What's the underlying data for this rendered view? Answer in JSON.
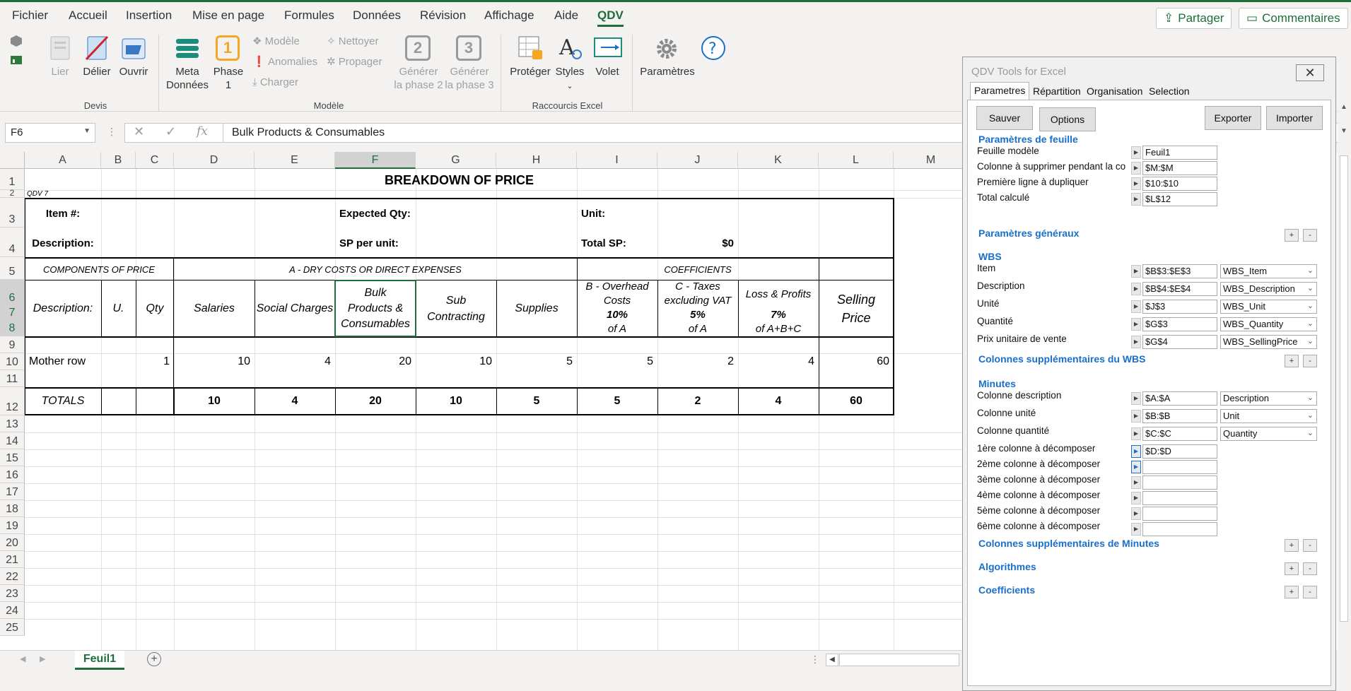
{
  "menu": {
    "items": [
      "Fichier",
      "Accueil",
      "Insertion",
      "Mise en page",
      "Formules",
      "Données",
      "Révision",
      "Affichage",
      "Aide",
      "QDV"
    ],
    "share": "Partager",
    "comments": "Commentaires"
  },
  "ribbon": {
    "lier": "Lier",
    "delier": "Délier",
    "ouvrir": "Ouvrir",
    "devis_group": "Devis",
    "meta": "Meta",
    "donnees": "Données",
    "phase": "Phase",
    "phase_num": "1",
    "modele_item": "Modèle",
    "anomalies": "Anomalies",
    "charger": "Charger",
    "nettoyer": "Nettoyer",
    "propager": "Propager",
    "generer": "Générer",
    "phase2": "la phase 2",
    "phase3": "la phase 3",
    "num2": "2",
    "num3": "3",
    "modele_group": "Modèle",
    "proteger": "Protéger",
    "styles": "Styles",
    "volet": "Volet",
    "raccourcis_group": "Raccourcis Excel",
    "parametres": "Paramètres"
  },
  "formula": {
    "namebox": "F6",
    "content": "Bulk Products & Consumables"
  },
  "grid": {
    "columns": [
      "A",
      "B",
      "C",
      "D",
      "E",
      "F",
      "G",
      "H",
      "I",
      "J",
      "K",
      "L",
      "M"
    ],
    "rows": [
      "1",
      "2",
      "3",
      "4",
      "5",
      "6",
      "7",
      "8",
      "9",
      "10",
      "11",
      "12",
      "13",
      "14",
      "15",
      "16",
      "17",
      "18",
      "19",
      "20",
      "21",
      "22",
      "23",
      "24",
      "25"
    ]
  },
  "sheet": {
    "title": "BREAKDOWN OF PRICE",
    "qdv": "QDV 7",
    "item": "Item #:",
    "description": "Description:",
    "expected_qty": "Expected Qty:",
    "sp_per_unit": "SP per unit:",
    "unit": "Unit:",
    "total_sp": "Total SP:",
    "total_sp_value": "$0",
    "components": "COMPONENTS OF PRICE",
    "dry_costs": "A - DRY COSTS OR DIRECT EXPENSES",
    "coefficients": "COEFFICIENTS",
    "h_description": "Description:",
    "h_unit": "U.",
    "h_qty": "Qty",
    "h_salaries": "Salaries",
    "h_social": "Social Charges",
    "h_bulk": "Bulk Products & Consumables",
    "h_sub": "Sub Contracting",
    "h_supplies": "Supplies",
    "h_overhead": "B - Overhead Costs",
    "h_taxes": "C - Taxes excluding VAT",
    "h_loss": "Loss & Profits",
    "h_selling": "Selling Price",
    "pct_b": "10%",
    "pct_c": "5%",
    "pct_k": "7%",
    "of_a": "of A",
    "of_a2": "of A",
    "of_abc": "of A+B+C",
    "mother_row": {
      "label": "Mother row",
      "qty": "1",
      "salaries": "10",
      "social": "4",
      "bulk": "20",
      "sub": "10",
      "supplies": "5",
      "overhead": "5",
      "taxes": "2",
      "loss": "4",
      "selling": "60"
    },
    "totals": {
      "label": "TOTALS",
      "salaries": "10",
      "social": "4",
      "bulk": "20",
      "sub": "10",
      "supplies": "5",
      "overhead": "5",
      "taxes": "2",
      "loss": "4",
      "selling": "60"
    }
  },
  "tabs": {
    "sheet1": "Feuil1"
  },
  "panel": {
    "title": "QDV Tools for Excel",
    "close": "✕",
    "tabs": [
      "Parametres",
      "Répartition",
      "Organisation",
      "Selection"
    ],
    "buttons": {
      "sauver": "Sauver",
      "options": "Options",
      "exporter": "Exporter",
      "importer": "Importer"
    },
    "sec_feuille": "Paramètres de feuille",
    "feuille_modele": "Feuille modèle",
    "feuille_modele_val": "Feuil1",
    "colonne_supprimer": "Colonne à supprimer pendant la co",
    "colonne_supprimer_val": "$M:$M",
    "premiere_ligne": "Première ligne à dupliquer",
    "premiere_ligne_val": "$10:$10",
    "total_calcule": "Total calculé",
    "total_calcule_val": "$L$12",
    "sec_generaux": "Paramètres généraux",
    "sec_wbs": "WBS",
    "wbs": [
      {
        "label": "Item",
        "value": "$B$3:$E$3",
        "option": "WBS_Item"
      },
      {
        "label": "Description",
        "value": "$B$4:$E$4",
        "option": "WBS_Description"
      },
      {
        "label": "Unité",
        "value": "$J$3",
        "option": "WBS_Unit"
      },
      {
        "label": "Quantité",
        "value": "$G$3",
        "option": "WBS_Quantity"
      },
      {
        "label": "Prix unitaire de vente",
        "value": "$G$4",
        "option": "WBS_SellingPrice"
      }
    ],
    "sec_wbs_extra": "Colonnes supplémentaires du WBS",
    "sec_minutes": "Minutes",
    "minutes": [
      {
        "label": "Colonne description",
        "value": "$A:$A",
        "option": "Description"
      },
      {
        "label": "Colonne unité",
        "value": "$B:$B",
        "option": "Unit"
      },
      {
        "label": "Colonne quantité",
        "value": "$C:$C",
        "option": "Quantity"
      }
    ],
    "decompose": [
      {
        "label": "1ère colonne à décomposer",
        "value": "$D:$D"
      },
      {
        "label": "2ème colonne à décomposer",
        "value": ""
      },
      {
        "label": "3ème colonne à décomposer",
        "value": ""
      },
      {
        "label": "4ème colonne à décomposer",
        "value": ""
      },
      {
        "label": "5ème colonne à décomposer",
        "value": ""
      },
      {
        "label": "6ème colonne à décomposer",
        "value": ""
      }
    ],
    "sec_minutes_extra": "Colonnes supplémentaires de Minutes",
    "sec_algorithmes": "Algorithmes",
    "sec_coefficients": "Coefficients",
    "plus": "+",
    "minus": "-"
  }
}
